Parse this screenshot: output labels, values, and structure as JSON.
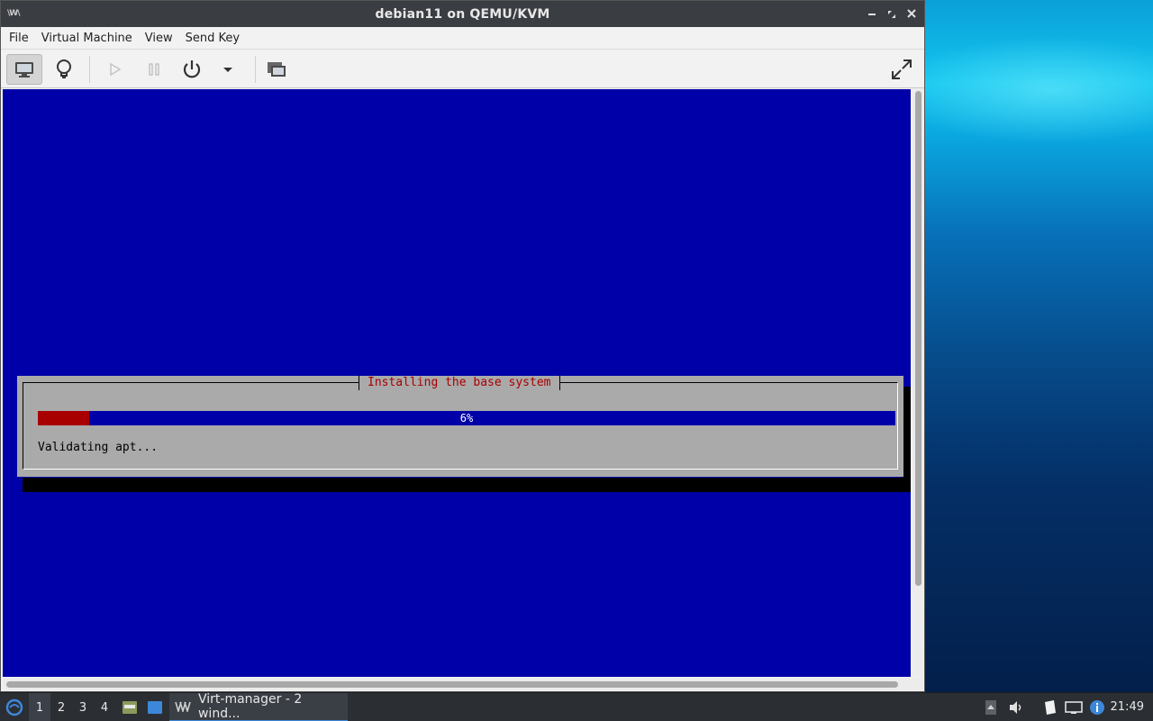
{
  "window": {
    "title": "debian11 on QEMU/KVM",
    "app_icon_text": "\\W\\"
  },
  "menubar": {
    "items": [
      "File",
      "Virtual Machine",
      "View",
      "Send Key"
    ]
  },
  "toolbar": {
    "buttons": [
      "console-view",
      "details-view",
      "run",
      "pause",
      "shutdown",
      "shutdown-menu",
      "snapshots",
      "fullscreen"
    ],
    "active": "console-view"
  },
  "installer": {
    "dialog_title": "Installing the base system",
    "progress_percent": 6,
    "progress_text": "6%",
    "status": "Validating apt...",
    "colors": {
      "background": "#0000a8",
      "dialog": "#aaaaaa",
      "title": "#a80000",
      "progress_fill": "#a80000"
    }
  },
  "taskbar": {
    "workspaces": [
      "1",
      "2",
      "3",
      "4"
    ],
    "current_workspace": "1",
    "task_label": "Virt-manager - 2 wind...",
    "clock": "21:49",
    "accent": "#3d87d9"
  }
}
